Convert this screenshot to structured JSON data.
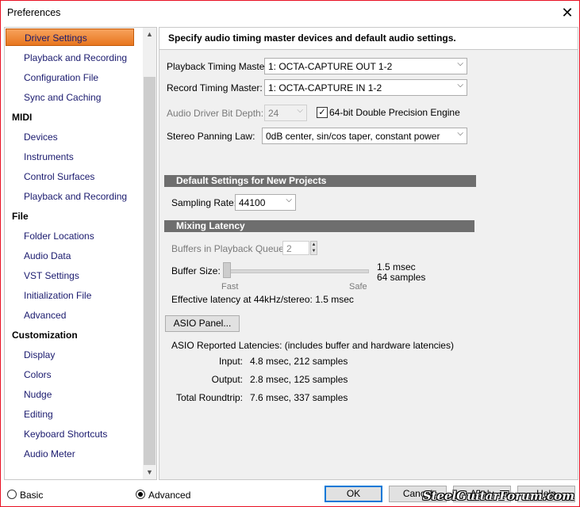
{
  "window": {
    "title": "Preferences"
  },
  "sidebar": {
    "items": [
      {
        "label": "Driver Settings",
        "kind": "child",
        "selected": true
      },
      {
        "label": "Playback and Recording",
        "kind": "child"
      },
      {
        "label": "Configuration File",
        "kind": "child"
      },
      {
        "label": "Sync and Caching",
        "kind": "child"
      },
      {
        "label": "MIDI",
        "kind": "cat"
      },
      {
        "label": "Devices",
        "kind": "child"
      },
      {
        "label": "Instruments",
        "kind": "child"
      },
      {
        "label": "Control Surfaces",
        "kind": "child"
      },
      {
        "label": "Playback and Recording",
        "kind": "child"
      },
      {
        "label": "File",
        "kind": "cat"
      },
      {
        "label": "Folder Locations",
        "kind": "child"
      },
      {
        "label": "Audio Data",
        "kind": "child"
      },
      {
        "label": "VST Settings",
        "kind": "child"
      },
      {
        "label": "Initialization File",
        "kind": "child"
      },
      {
        "label": "Advanced",
        "kind": "child"
      },
      {
        "label": "Customization",
        "kind": "cat"
      },
      {
        "label": "Display",
        "kind": "child"
      },
      {
        "label": "Colors",
        "kind": "child"
      },
      {
        "label": "Nudge",
        "kind": "child"
      },
      {
        "label": "Editing",
        "kind": "child"
      },
      {
        "label": "Keyboard Shortcuts",
        "kind": "child"
      },
      {
        "label": "Audio Meter",
        "kind": "child"
      }
    ]
  },
  "panel": {
    "header": "Specify audio timing master devices and default audio settings.",
    "playback_master": {
      "label": "Playback Timing Master:",
      "value": "1: OCTA-CAPTURE OUT 1-2"
    },
    "record_master": {
      "label": "Record Timing Master:",
      "value": "1: OCTA-CAPTURE IN 1-2"
    },
    "bit_depth": {
      "label": "Audio Driver Bit Depth:",
      "value": "24"
    },
    "double_precision": {
      "label": "64-bit Double Precision Engine",
      "checked": true
    },
    "panning": {
      "label": "Stereo Panning Law:",
      "value": "0dB center, sin/cos taper, constant power"
    },
    "default_settings_title": "Default Settings for New Projects",
    "sampling_rate": {
      "label": "Sampling Rate:",
      "value": "44100"
    },
    "mixing_latency_title": "Mixing Latency",
    "buffers": {
      "label": "Buffers in Playback Queue:",
      "value": "2"
    },
    "buffer_size": {
      "label": "Buffer Size:",
      "min_label": "Fast",
      "max_label": "Safe",
      "msec": "1.5 msec",
      "samples": "64 samples",
      "position": 0.0
    },
    "effective_latency": "Effective latency at 44kHz/stereo:  1.5 msec",
    "asio_panel_button": "ASIO Panel...",
    "asio_reported": "ASIO Reported Latencies: (includes buffer and hardware latencies)",
    "latencies": [
      {
        "label": "Input:",
        "value": "4.8 msec, 212 samples"
      },
      {
        "label": "Output:",
        "value": "2.8 msec, 125 samples"
      },
      {
        "label": "Total Roundtrip:",
        "value": "7.6 msec, 337 samples"
      }
    ]
  },
  "footer": {
    "basic_label": "Basic",
    "advanced_label": "Advanced",
    "mode": "advanced",
    "ok": "OK",
    "cancel": "Cancel",
    "apply": "Apply",
    "help": "Help"
  },
  "watermark": "SteelGuitarForum.com",
  "colors": {
    "selected_gradient_top": "#f7a25c",
    "selected_gradient_bottom": "#e8761f",
    "section_bar": "#6e6e6e",
    "link_text": "#1a1a6e"
  }
}
